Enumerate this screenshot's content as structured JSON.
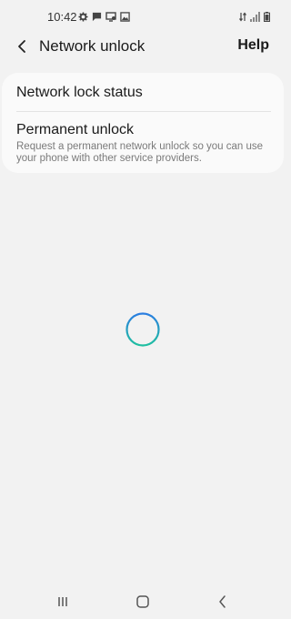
{
  "status_bar": {
    "time": "10:42",
    "left_icons": [
      "settings-gear-icon",
      "message-icon",
      "cast-icon",
      "gallery-icon"
    ],
    "right_icons": [
      "data-transfer-icon",
      "signal-icon",
      "battery-icon"
    ]
  },
  "app_bar": {
    "title": "Network unlock",
    "help_label": "Help",
    "back_icon": "chevron-left-icon"
  },
  "card": {
    "items": [
      {
        "title": "Network lock status"
      },
      {
        "title": "Permanent unlock",
        "description": "Request a permanent network unlock so you can use your phone with other service providers."
      }
    ]
  },
  "loading": {
    "indicator": "loading-spinner-icon",
    "colors": [
      "#2a7de1",
      "#1fbfa0"
    ]
  },
  "nav_bar": {
    "buttons": [
      "recents-icon",
      "home-icon",
      "back-icon"
    ]
  }
}
